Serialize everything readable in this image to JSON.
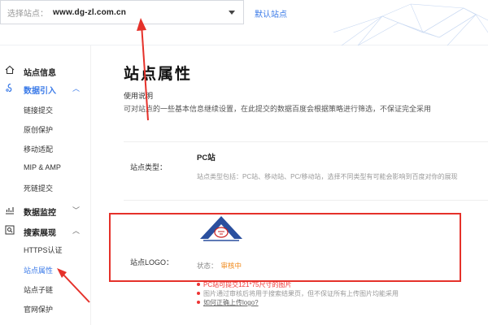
{
  "header": {
    "site_select_label": "选择站点：",
    "site_select_value": "www.dg-zl.com.cn",
    "default_site_link": "默认站点"
  },
  "sidebar": {
    "groups": [
      {
        "label": "站点信息",
        "icon": "home-icon"
      },
      {
        "label": "数据引入",
        "icon": "data-import-icon",
        "expanded": true
      },
      {
        "label": "数据监控",
        "icon": "chart-icon",
        "expanded": false
      },
      {
        "label": "搜索展现",
        "icon": "search-display-icon",
        "expanded": true
      }
    ],
    "items": [
      {
        "label": "链接提交"
      },
      {
        "label": "原创保护"
      },
      {
        "label": "移动适配"
      },
      {
        "label": "MIP & AMP"
      },
      {
        "label": "死链提交"
      },
      {
        "label": "HTTPS认证"
      },
      {
        "label": "站点属性",
        "active": true
      },
      {
        "label": "站点子链"
      },
      {
        "label": "官网保护"
      }
    ]
  },
  "main": {
    "title": "站点属性",
    "usage_title": "使用说明",
    "usage_text": "可对站点的一些基本信息继续设置，在此提交的数据百度会根据策略进行筛选，不保证完全采用",
    "site_type_label": "站点类型：",
    "site_type_value": "PC站",
    "site_type_desc": "站点类型包括：PC站、移动站、PC/移动站，选择不同类型有可能会影响到百度对你的展现",
    "logo_label": "站点LOGO：",
    "status_label": "状态：",
    "status_value": "审核中",
    "tips": [
      "PC站可提交121*75尺寸的图片",
      "图片通过审核后将用于搜索结果页，但不保证所有上传图片均能采用",
      "如何正确上传logo?"
    ]
  },
  "colors": {
    "accent": "#3a7ae8",
    "annotation_red": "#e5312a",
    "status_pending": "#f08a1c"
  }
}
